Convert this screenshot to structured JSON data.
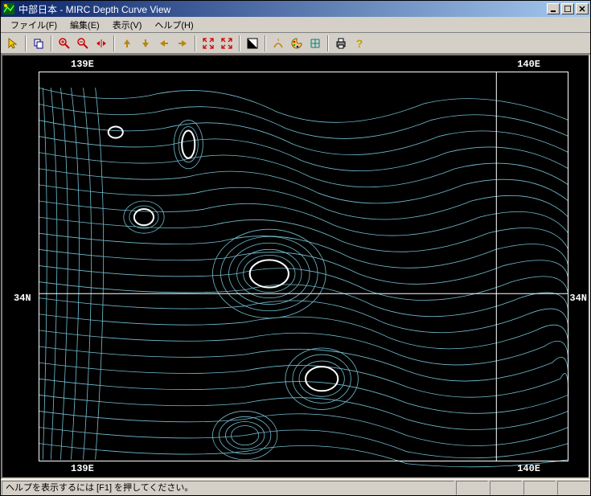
{
  "window": {
    "title": "中部日本 - MIRC Depth Curve View"
  },
  "menu": {
    "file": "ファイル(F)",
    "edit": "編集(E)",
    "view": "表示(V)",
    "help": "ヘルプ(H)"
  },
  "toolbar": {
    "pointer": "pointer",
    "copy": "copy",
    "zoom_in": "zoom-in",
    "zoom_out": "zoom-out",
    "fit": "fit",
    "up": "up",
    "down": "down",
    "left": "left",
    "right": "right",
    "shrink": "shrink",
    "expand": "expand",
    "contrast": "contrast",
    "measure": "measure",
    "palette": "palette",
    "grid": "grid",
    "print": "print",
    "help": "help"
  },
  "map": {
    "axis": {
      "top_left_lon": "139E",
      "top_right_lon": "140E",
      "bottom_left_lon": "139E",
      "bottom_right_lon": "140E",
      "left_lat": "34N",
      "right_lat": "34N"
    },
    "grid_color": "#ffffff",
    "contour_color": "#88ddee",
    "highlight_color": "#ffffff"
  },
  "status": {
    "text": "ヘルプを表示するには [F1] を押してください。"
  }
}
